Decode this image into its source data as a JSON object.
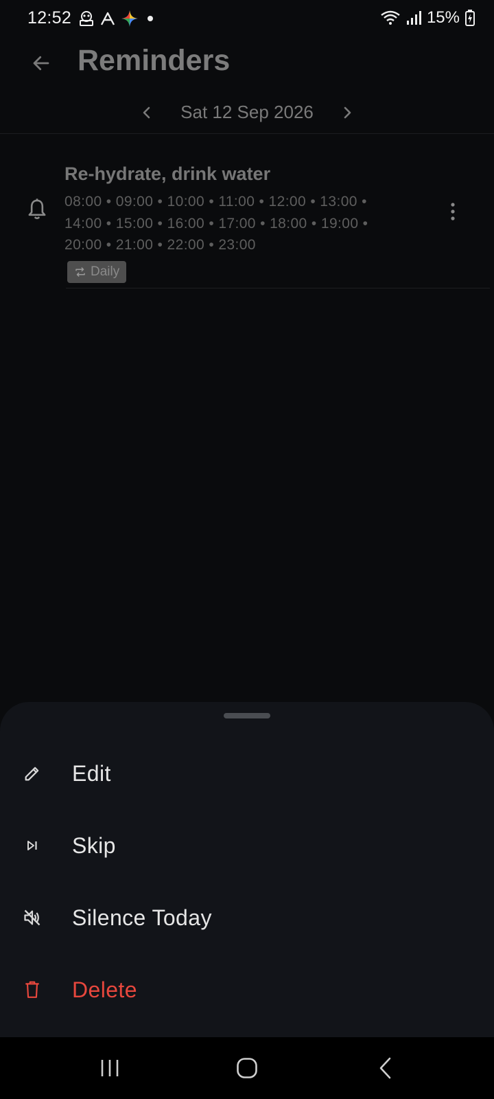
{
  "status_bar": {
    "time": "12:52",
    "battery": "15%",
    "left_icons": [
      "notification-icon",
      "app-a-icon",
      "gemini-sparkle-icon",
      "dot-icon"
    ],
    "right_icons": [
      "wifi-icon",
      "signal-icon",
      "battery-icon"
    ]
  },
  "app_bar": {
    "title": "Reminders",
    "back_icon": "arrow-left-icon"
  },
  "date_nav": {
    "date": "Sat 12 Sep 2026",
    "prev_icon": "chevron-left-icon",
    "next_icon": "chevron-right-icon"
  },
  "reminder": {
    "title": "Re-hydrate, drink water",
    "times": "08:00 • 09:00 • 10:00 • 11:00 • 12:00 • 13:00 • 14:00 • 15:00 • 16:00 • 17:00 • 18:00 • 19:00 • 20:00 • 21:00 • 22:00 • 23:00",
    "repeat_label": "Daily",
    "icon": "bell-icon",
    "more_icon": "more-vert-icon"
  },
  "sheet": {
    "items": [
      {
        "label": "Edit",
        "icon": "pencil-icon"
      },
      {
        "label": "Skip",
        "icon": "skip-next-icon"
      },
      {
        "label": "Silence Today",
        "icon": "volume-off-icon"
      },
      {
        "label": "Delete",
        "icon": "trash-icon"
      }
    ]
  },
  "colors": {
    "background": "#0a0b0d",
    "sheet": "#121419",
    "danger": "#e7473d",
    "muted_text": "#777777"
  },
  "nav_bar": {
    "icons": [
      "recents-icon",
      "home-icon",
      "back-icon"
    ]
  }
}
